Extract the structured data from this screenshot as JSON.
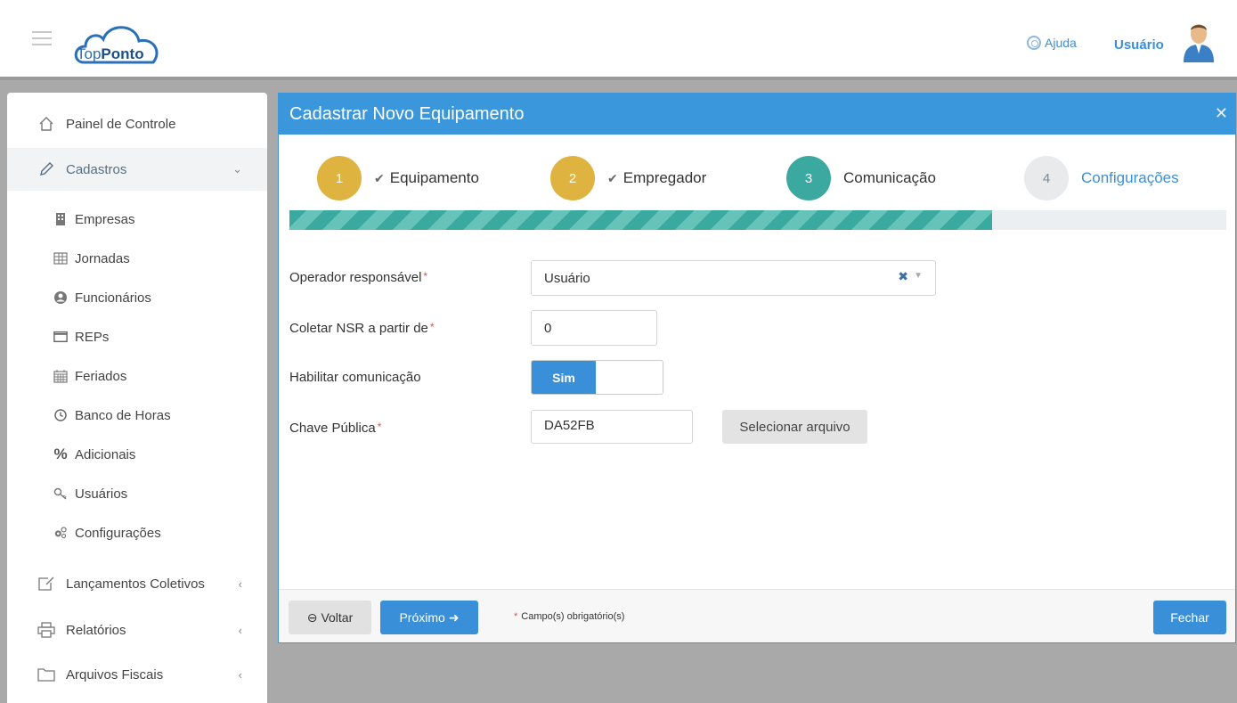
{
  "header": {
    "logo_prefix": "Top",
    "logo_suffix": "Ponto",
    "help_label": "Ajuda",
    "user_label": "Usuário"
  },
  "sidebar": {
    "dashboard": "Painel de Controle",
    "cadastros": "Cadastros",
    "sub_items": [
      "Empresas",
      "Jornadas",
      "Funcionários",
      "REPs",
      "Feriados",
      "Banco de Horas",
      "Adicionais",
      "Usuários",
      "Configurações"
    ],
    "lancamentos": "Lançamentos Coletivos",
    "relatorios": "Relatórios",
    "arquivos": "Arquivos Fiscais"
  },
  "modal": {
    "title": "Cadastrar Novo Equipamento",
    "steps": [
      {
        "number": "1",
        "label": "Equipamento",
        "state": "done"
      },
      {
        "number": "2",
        "label": "Empregador",
        "state": "done"
      },
      {
        "number": "3",
        "label": "Comunicação",
        "state": "current"
      },
      {
        "number": "4",
        "label": "Configurações",
        "state": "todo"
      }
    ],
    "progress_fraction": 0.75,
    "form": {
      "operador_label": "Operador responsável",
      "operador_value": "Usuário",
      "nsr_label": "Coletar NSR a partir de",
      "nsr_value": "0",
      "comunicacao_label": "Habilitar comunicação",
      "comunicacao_value": "Sim",
      "chave_label": "Chave Pública",
      "chave_value": "DA52FB",
      "file_button": "Selecionar arquivo"
    },
    "footer": {
      "back_label": "Voltar",
      "next_label": "Próximo",
      "required_note": "Campo(s) obrigatório(s)",
      "close_label": "Fechar"
    }
  },
  "colors": {
    "accent": "#3a8fd9",
    "step_done": "#dfb33f",
    "step_current": "#3ba9a0",
    "required": "#e05050"
  }
}
